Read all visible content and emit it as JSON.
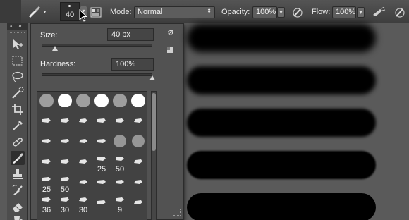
{
  "options_bar": {
    "brush_size": "40",
    "mode_label": "Mode:",
    "mode_value": "Normal",
    "opacity_label": "Opacity:",
    "opacity_value": "100%",
    "flow_label": "Flow:",
    "flow_value": "100%"
  },
  "brush_picker": {
    "size_label": "Size:",
    "size_value": "40 px",
    "size_fraction": 0.12,
    "hardness_label": "Hardness:",
    "hardness_value": "100%",
    "hardness_fraction": 1.0,
    "presets": [
      [
        "",
        "",
        "",
        "",
        "",
        ""
      ],
      [
        "",
        "",
        "",
        "",
        "",
        ""
      ],
      [
        "",
        "",
        "",
        "",
        "",
        ""
      ],
      [
        "",
        "",
        "",
        "25",
        "50",
        ""
      ],
      [
        "25",
        "50",
        "",
        "",
        "",
        ""
      ],
      [
        "36",
        "30",
        "30",
        "",
        "9",
        ""
      ]
    ]
  },
  "tools": [
    "move-tool",
    "marquee-tool",
    "lasso-tool",
    "quick-select-tool",
    "crop-tool",
    "eyedropper-tool",
    "healing-tool",
    "brush-tool",
    "clone-stamp-tool",
    "history-brush-tool",
    "eraser-tool",
    "paint-bucket-tool"
  ],
  "canvas": {
    "stroke_count": 5
  }
}
